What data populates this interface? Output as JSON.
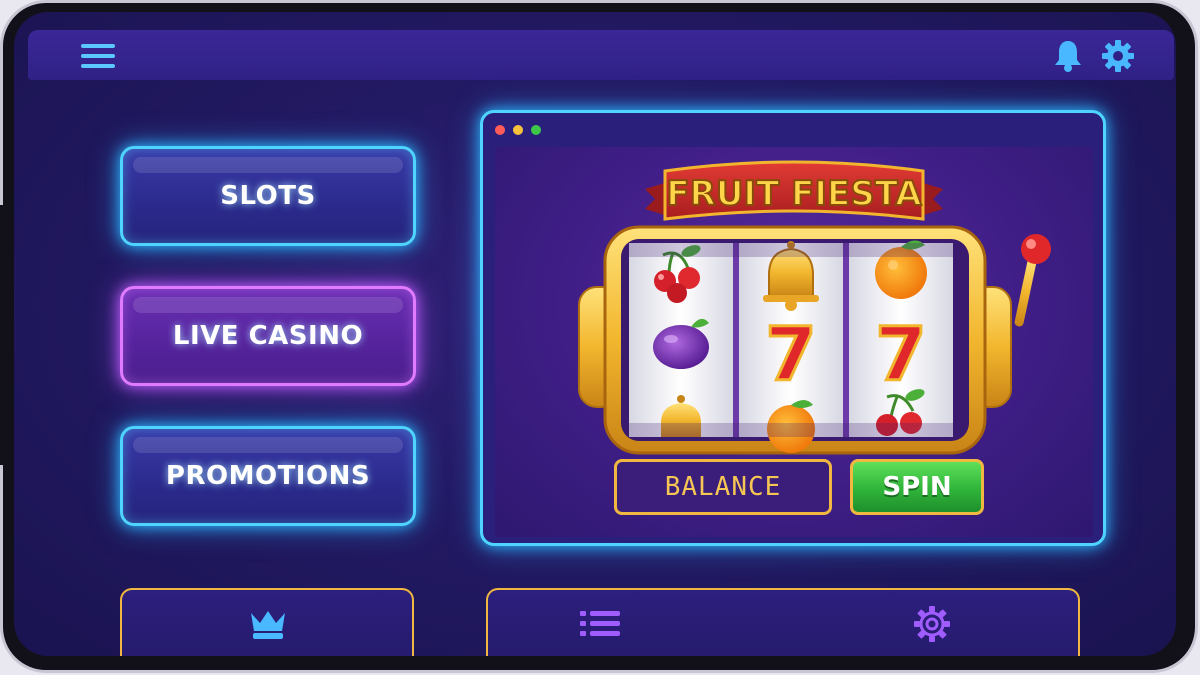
{
  "nav": {
    "slots_label": "SLOTS",
    "live_casino_label": "LIVE CASINO",
    "promotions_label": "PROMOTIONS"
  },
  "game": {
    "title": "FRUIT FIESTA",
    "balance_label": "BALANCE",
    "spin_label": "SPIN",
    "reels": [
      [
        "cherry",
        "plum",
        "bell"
      ],
      [
        "bell",
        "seven",
        "orange"
      ],
      [
        "orange",
        "seven",
        "cherry"
      ]
    ],
    "seven_glyph": "7"
  },
  "icons": {
    "menu": "hamburger-menu-icon",
    "bell": "bell-icon",
    "settings": "gear-icon",
    "crown": "crown-icon",
    "list": "list-icon",
    "bottom_settings": "gear-icon"
  },
  "colors": {
    "neon_blue": "#4fd4ff",
    "neon_purple": "#e07bff",
    "gold": "#f0b840",
    "spin_green": "#2fb43a",
    "window_dot_red": "#ff5b5b",
    "window_dot_yellow": "#f6c23b",
    "window_dot_green": "#3ec84a"
  }
}
